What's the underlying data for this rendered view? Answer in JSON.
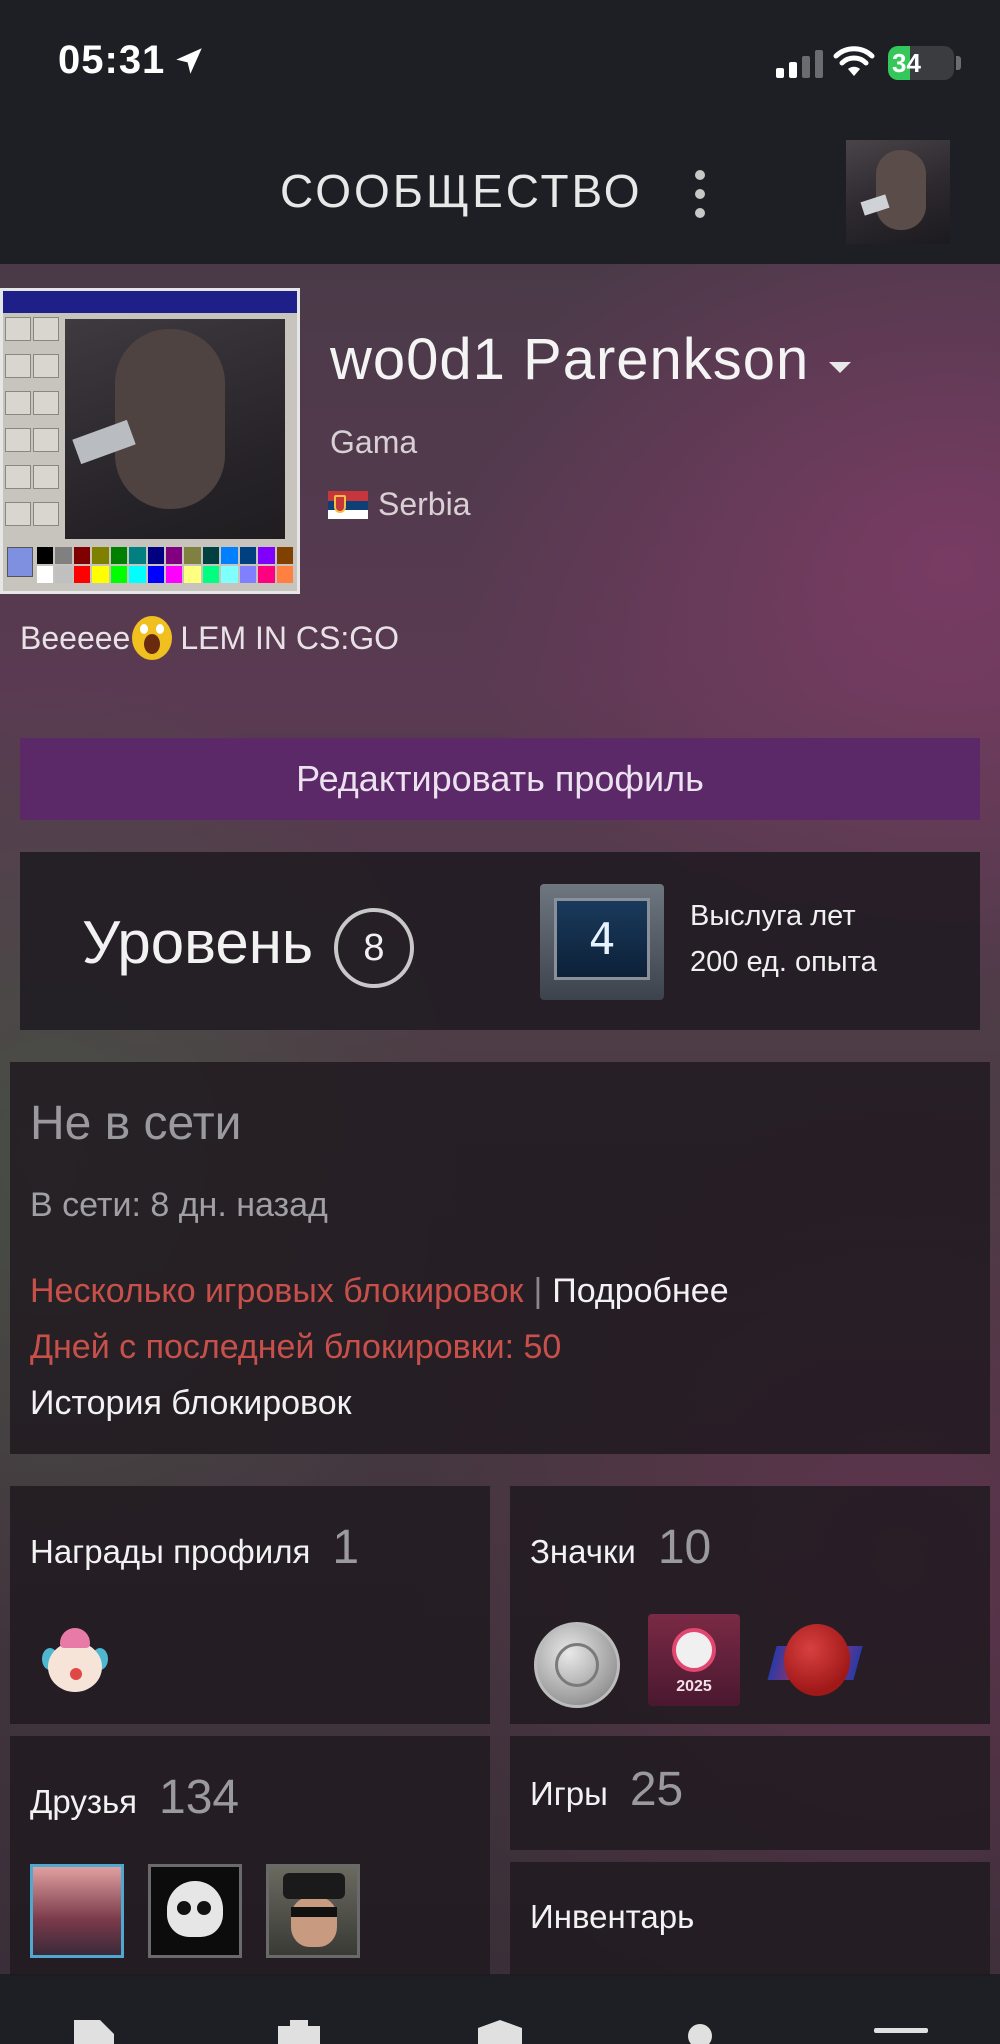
{
  "status_bar": {
    "time": "05:31",
    "battery": "34",
    "battery_level": 0.34,
    "accent": "#34c759"
  },
  "header": {
    "title": "СООБЩЕСТВО"
  },
  "profile": {
    "persona_name": "wo0d1 Parenkson",
    "real_name": "Gama",
    "country": "Serbia",
    "summary_before": "Beeeee",
    "summary_after": "LEM IN CS:GO",
    "edit_button": "Редактировать профиль",
    "accent": "#5b2868"
  },
  "level": {
    "label": "Уровень",
    "value": "8",
    "badge_years": "4",
    "badge_name": "Выслуга лет",
    "badge_xp": "200 ед. опыта"
  },
  "status": {
    "state": "Не в сети",
    "last_online": "В сети: 8 дн. назад",
    "bans_label": "Несколько игровых блокировок",
    "separator": "|",
    "details_link": "Подробнее",
    "days_since_ban": "Дней с последней блокировки: 50",
    "ban_history": "История блокировок",
    "ban_color": "#c8504a"
  },
  "tiles": {
    "awards": {
      "label": "Награды профиля",
      "count": "1"
    },
    "badges": {
      "label": "Значки",
      "count": "10",
      "badge_year": "2025"
    },
    "friends": {
      "label": "Друзья",
      "count": "134"
    },
    "games": {
      "label": "Игры",
      "count": "25"
    },
    "inventory": {
      "label": "Инвентарь"
    }
  }
}
